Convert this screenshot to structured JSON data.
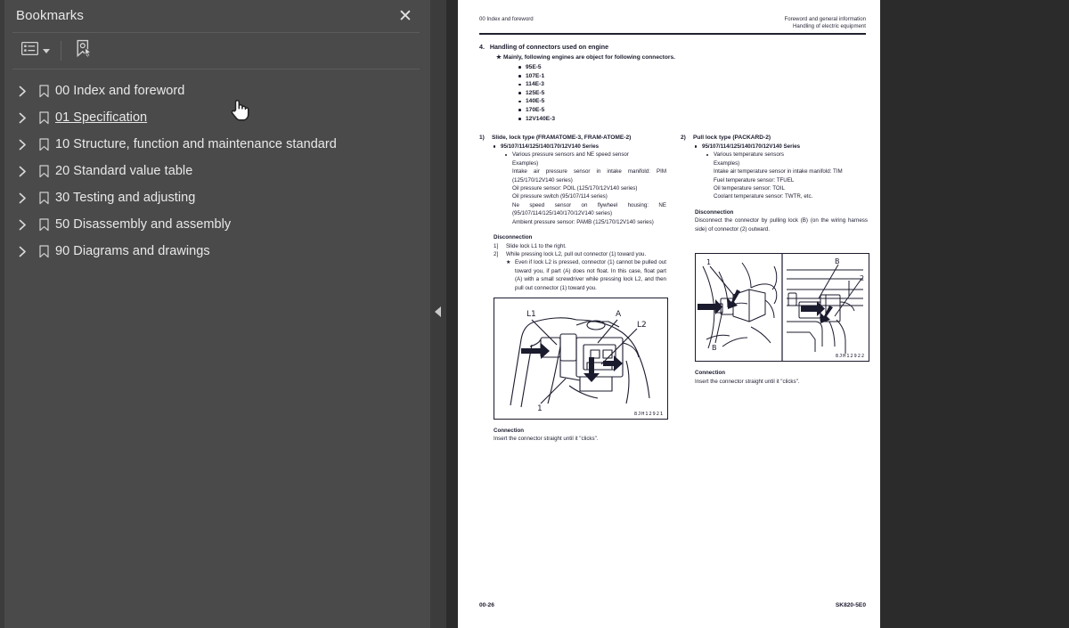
{
  "panel": {
    "title": "Bookmarks",
    "close_label": "✕",
    "toolbar": {
      "options_icon": "bookmark-options-icon",
      "new_bookmark_icon": "new-bookmark-icon"
    },
    "items": [
      {
        "label": "00 Index and foreword",
        "expand_icon": "chevron-right-icon",
        "mark_icon": "bookmark-icon",
        "hovered": false
      },
      {
        "label": "01 Specification",
        "expand_icon": "chevron-right-icon",
        "mark_icon": "bookmark-icon",
        "hovered": true
      },
      {
        "label": "10 Structure, function and maintenance standard",
        "expand_icon": "chevron-right-icon",
        "mark_icon": "bookmark-icon",
        "hovered": false
      },
      {
        "label": "20 Standard value table",
        "expand_icon": "chevron-right-icon",
        "mark_icon": "bookmark-icon",
        "hovered": false
      },
      {
        "label": "30 Testing and adjusting",
        "expand_icon": "chevron-right-icon",
        "mark_icon": "bookmark-icon",
        "hovered": false
      },
      {
        "label": "50 Disassembly and assembly",
        "expand_icon": "chevron-right-icon",
        "mark_icon": "bookmark-icon",
        "hovered": false
      },
      {
        "label": "90 Diagrams and drawings",
        "expand_icon": "chevron-right-icon",
        "mark_icon": "bookmark-icon",
        "hovered": false
      }
    ]
  },
  "splitter": {
    "collapse_icon": "collapse-left-arrow-icon"
  },
  "cursor": {
    "type": "pointing-hand-cursor"
  },
  "document": {
    "header_left": "00 Index and foreword",
    "header_right_line1": "Foreword and general information",
    "header_right_line2": "Handling of electric equipment",
    "section_number": "4.",
    "section_title": "Handling of connectors used on engine",
    "star_note": "Mainly, following engines are object for following connectors.",
    "engines": [
      "95E-5",
      "107E-1",
      "114E-3",
      "125E-5",
      "140E-5",
      "170E-5",
      "12V140E-3"
    ],
    "left_column": {
      "number": "1)",
      "heading": "Slide, lock type  (FRAMATOME-3, FRAM-ATOME-2)",
      "bullet1": "95/107/114/125/140/170/12V140 Series",
      "bullet2": "Various pressure sensors and NE speed sensor",
      "lines": [
        "Examples)",
        "Intake air pressure sensor in intake manifold: PIM (125/170/12V140 series)",
        "Oil pressure sensor: POIL (125/170/12V140 series)",
        "Oil pressure switch (95/107/114 series)",
        "Ne speed sensor on flywheel housing: NE (95/107/114/125/140/170/12V140 series)",
        "Ambient pressure sensor: PAMB (125/170/12V140 series)"
      ],
      "disconnection_heading": "Disconnection",
      "steps": [
        {
          "n": "1]",
          "text": "Slide lock L1 to the right."
        },
        {
          "n": "2]",
          "text": "While pressing lock L2, pull out connector (1) toward you."
        }
      ],
      "step_note": "Even if lock L2 is pressed, connector (1) cannot be pulled out toward you, if part (A) does not float. In this case, float part (A) with a small screwdriver while pressing lock L2, and then pull out connector (1) toward you.",
      "figure_code": "8JH12921",
      "figure_labels": [
        "L1",
        "A",
        "L2",
        "1"
      ],
      "connection_heading": "Connection",
      "connection_text": "Insert the connector straight until it \"clicks\"."
    },
    "right_column": {
      "number": "2)",
      "heading": "Pull lock type (PACKARD-2)",
      "bullet1": "95/107/114/125/140/170/12V140 Series",
      "bullet2": "Various temperature sensors",
      "lines": [
        "Examples)",
        "Intake air temperature sensor in intake manifold: TIM",
        "Fuel temperature sensor: TFUEL",
        "Oil temperature sensor: TOIL",
        "Coolant temperature sensor: TWTR, etc."
      ],
      "disconnection_heading": "Disconnection",
      "disconnection_text": "Disconnect the connector by pulling lock (B) (on the wiring harness side) of connector (2) outward.",
      "figure_code": "8JH12922",
      "figure_labels": [
        "1",
        "B",
        "B",
        "2"
      ],
      "connection_heading": "Connection",
      "connection_text": "Insert the connector straight until it \"clicks\"."
    },
    "footer_left": "00-26",
    "footer_right": "SK820-5E0"
  },
  "colors": {
    "panel_bg": "#4a4a4a",
    "viewer_bg": "#2b2b2b",
    "splitter_bg": "#3c3c3c",
    "text": "#e9e9e9",
    "page_bg": "#ffffff",
    "doc_ink": "#1b1b2e"
  }
}
